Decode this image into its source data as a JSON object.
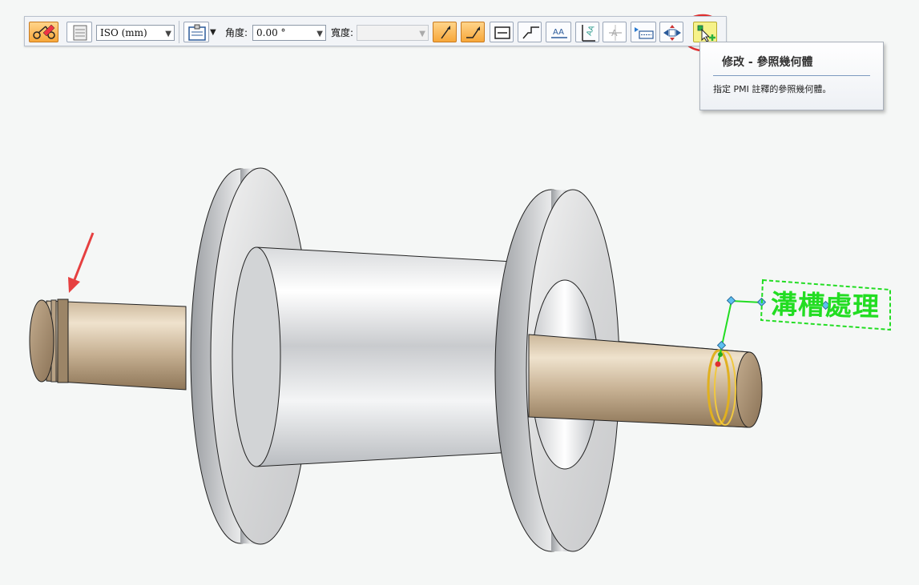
{
  "toolbar": {
    "standard_value": "ISO (mm)",
    "angle_label": "角度:",
    "angle_value": "0.00 °",
    "width_label": "寬度:",
    "width_value": "",
    "buttons": [
      "smart-dimension-icon",
      "dimension-style-icon",
      "annotation-properties-icon",
      "leader-arrow-icon",
      "bent-leader-icon",
      "text-frame-icon",
      "step-leader-icon",
      "underline-text-icon",
      "vertical-text-icon",
      "strikeout-text-icon",
      "text-box-icon",
      "fit-arrows-icon",
      "modify-reference-geometry-icon"
    ],
    "active_color": "#f7a73a"
  },
  "tooltip": {
    "title": "修改 - 參照幾何體",
    "description": "指定 PMI 註釋的參照幾何體。"
  },
  "model": {
    "annotation_text": "溝槽處理",
    "annotation_color": "#22dd22",
    "highlight_color": "#e0b020",
    "callout_arrow_color": "#e64040",
    "callout_circle_color": "#e03030"
  }
}
